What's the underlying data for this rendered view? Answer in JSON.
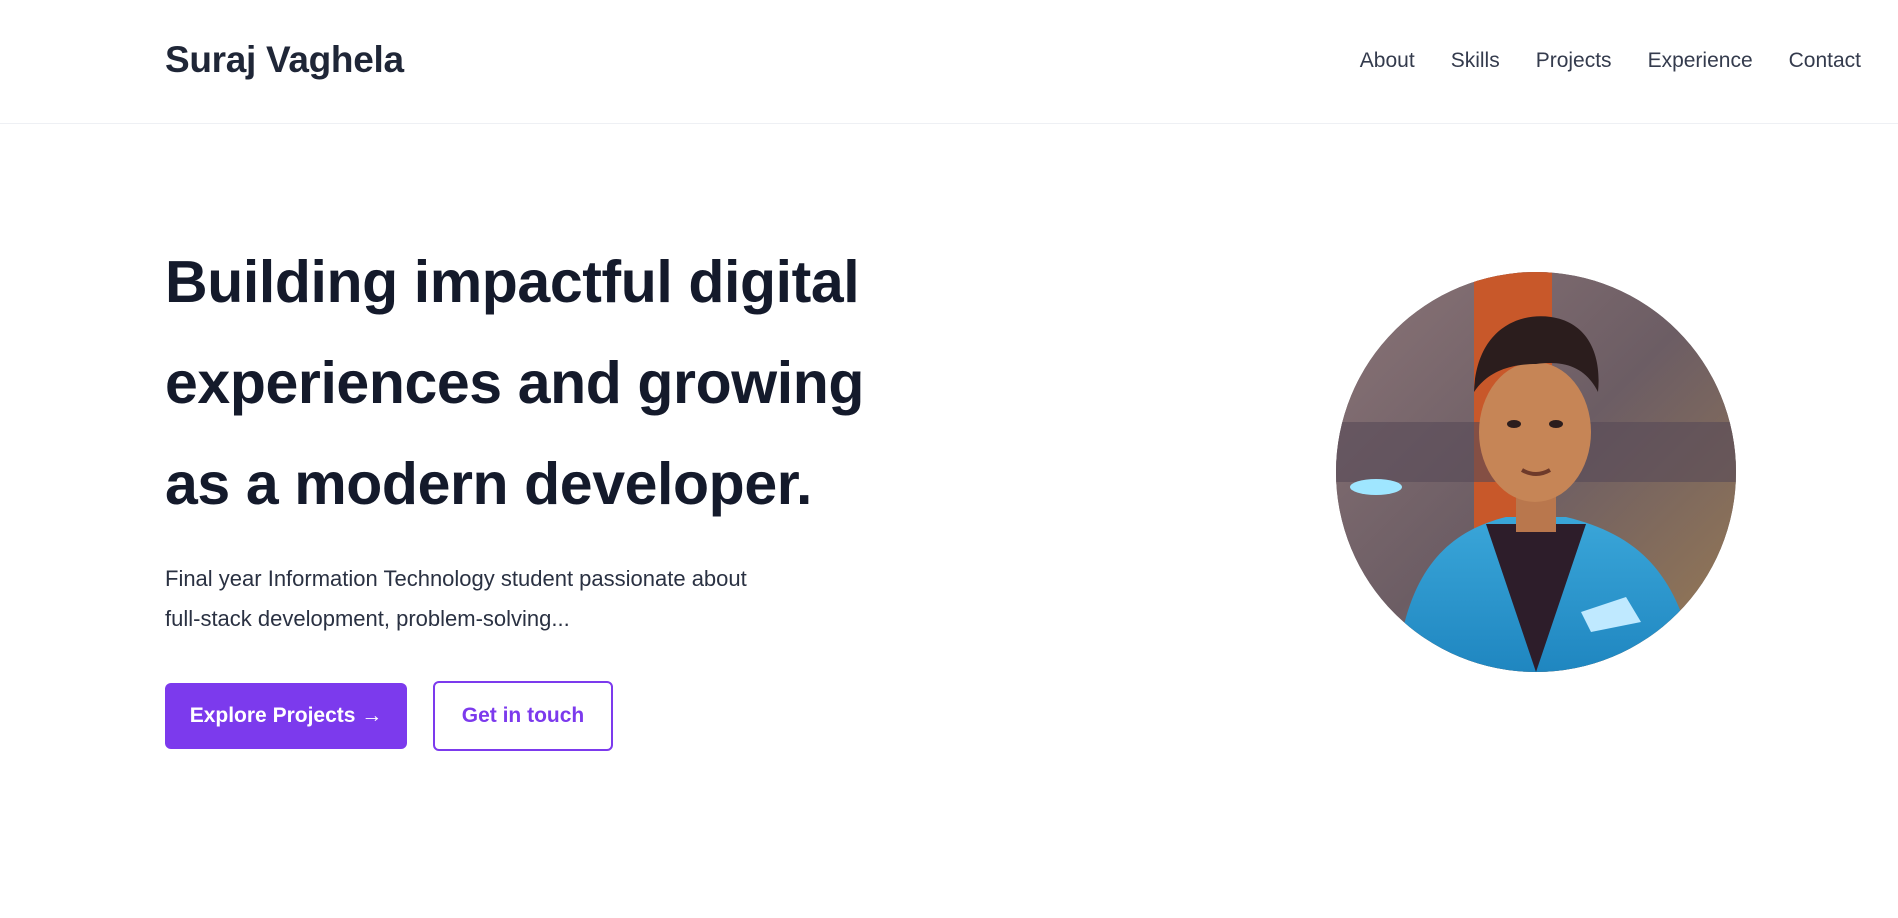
{
  "header": {
    "logo": "Suraj Vaghela",
    "nav": [
      {
        "label": "About"
      },
      {
        "label": "Skills"
      },
      {
        "label": "Projects"
      },
      {
        "label": "Experience"
      },
      {
        "label": "Contact"
      }
    ]
  },
  "hero": {
    "title_lines": [
      "Building impactful digital",
      "experiences and growing",
      "as a modern developer."
    ],
    "description_lines": [
      "Final year Information Technology student passionate about",
      "full-stack development, problem-solving..."
    ],
    "primary_button": "Explore Projects →",
    "secondary_button": "Get in touch"
  },
  "colors": {
    "accent": "#7c3aed",
    "text_dark": "#141a2b",
    "nav_text": "#343b4d",
    "background": "#ffffff"
  },
  "avatar": {
    "icon": "profile-photo"
  }
}
